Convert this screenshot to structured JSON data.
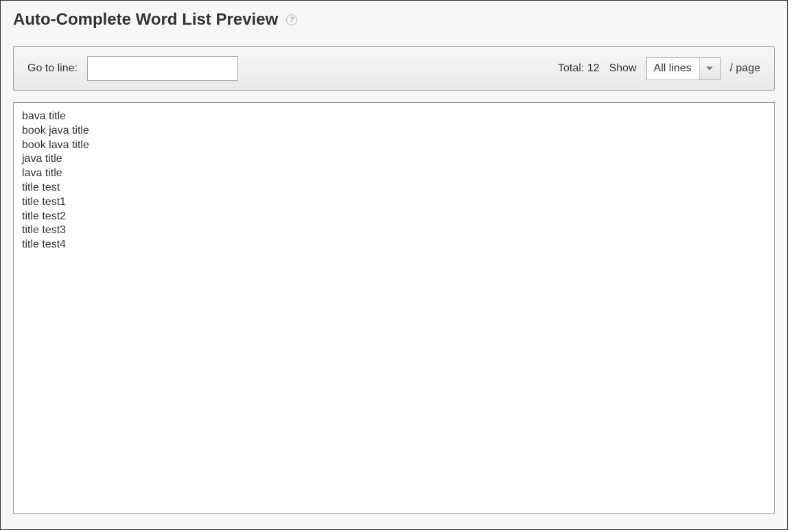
{
  "header": {
    "title": "Auto-Complete Word List Preview"
  },
  "toolbar": {
    "goto_label": "Go to line:",
    "goto_value": "",
    "total_label": "Total:",
    "total_count": 12,
    "show_label": "Show",
    "page_suffix": "/ page",
    "select_value": "All lines"
  },
  "word_list": [
    "bava title",
    "book java title",
    "book lava title",
    "java title",
    "lava title",
    "title test",
    "title test1",
    "title test2",
    "title test3",
    "title test4"
  ]
}
